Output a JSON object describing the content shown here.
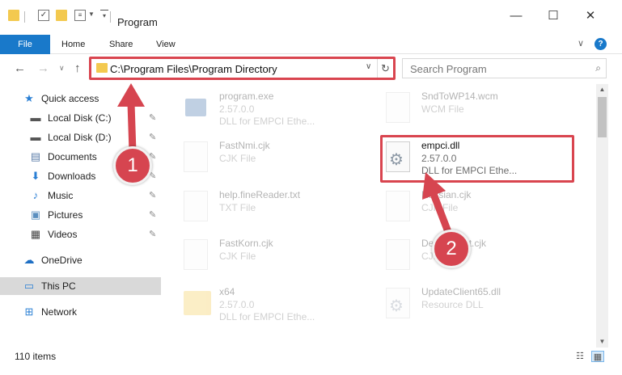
{
  "window": {
    "title": "Program",
    "minimize_glyph": "—",
    "maximize_glyph": "☐",
    "close_glyph": "✕"
  },
  "ribbon": {
    "file": "File",
    "home": "Home",
    "share": "Share",
    "view": "View",
    "expand_glyph": "∨",
    "help_glyph": "?"
  },
  "address": {
    "path": "C:\\Program Files\\Program Directory",
    "dropdown_glyph": "∨",
    "refresh_glyph": "↻",
    "back_glyph": "←",
    "forward_glyph": "→",
    "recent_glyph": "∨",
    "up_glyph": "↑"
  },
  "search": {
    "placeholder": "Search Program",
    "icon_glyph": "⌕"
  },
  "nav": {
    "quick_access": "Quick access",
    "items": [
      {
        "label": "Local Disk (C:)",
        "pinned": true
      },
      {
        "label": "Local Disk (D:)",
        "pinned": true
      },
      {
        "label": "Documents",
        "pinned": true
      },
      {
        "label": "Downloads",
        "pinned": true
      },
      {
        "label": "Music",
        "pinned": true
      },
      {
        "label": "Pictures",
        "pinned": true
      },
      {
        "label": "Videos",
        "pinned": true
      }
    ],
    "onedrive": "OneDrive",
    "this_pc": "This PC",
    "network": "Network",
    "pin_glyph": "📌"
  },
  "files": [
    {
      "name": "program.exe",
      "line1": "2.57.0.0",
      "line2": "DLL for EMPCI  Ethe...",
      "icon": "exe",
      "faded": true
    },
    {
      "name": "SndToWP14.wcm",
      "line1": "WCM File",
      "line2": "",
      "icon": "file",
      "faded": true
    },
    {
      "name": "FastNmi.cjk",
      "line1": "CJK File",
      "line2": "",
      "icon": "file",
      "faded": true
    },
    {
      "name": "empci.dll",
      "line1": "2.57.0.0",
      "line2": "DLL for EMPCI  Ethe...",
      "icon": "dll",
      "faded": false
    },
    {
      "name": "help.fineReader.txt",
      "line1": "TXT File",
      "line2": "",
      "icon": "file",
      "faded": true
    },
    {
      "name": "Russian.cjk",
      "line1": "CJK File",
      "line2": "",
      "icon": "file",
      "faded": true
    },
    {
      "name": "FastKorn.cjk",
      "line1": "CJK File",
      "line2": "",
      "icon": "file",
      "faded": true
    },
    {
      "name": "DefaultFont.cjk",
      "line1": "CJK File",
      "line2": "",
      "icon": "file",
      "faded": true
    },
    {
      "name": "x64",
      "line1": "2.57.0.0",
      "line2": "DLL for EMPCI  Ethe...",
      "icon": "folder",
      "faded": true
    },
    {
      "name": "UpdateClient65.dll",
      "line1": "Resource DLL",
      "line2": "",
      "icon": "dll",
      "faded": true
    }
  ],
  "status": {
    "item_count": "110 items",
    "details_view_glyph": "☷",
    "tiles_view_glyph": "▦"
  },
  "annotations": {
    "step1": "1",
    "step2": "2",
    "accent": "#d64550"
  },
  "colors": {
    "file_tab": "#1979ca",
    "highlight": "#d9454f",
    "folder": "#f3c94f"
  }
}
